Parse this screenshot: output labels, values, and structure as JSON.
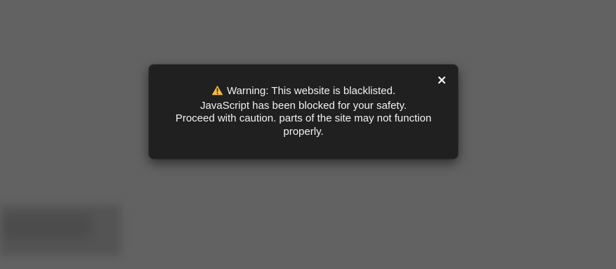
{
  "dialog": {
    "close_icon": "close-icon",
    "warning_icon": "warning-triangle-icon",
    "warning_color": "#f5b942",
    "lines": [
      "Warning: This website is blacklisted.",
      "JavaScript has been blocked for your safety.",
      "Proceed with caution. parts of the site may not function properly."
    ]
  },
  "colors": {
    "overlay": "#626262",
    "dialog_bg": "#202020",
    "text": "#f2f2f2"
  }
}
